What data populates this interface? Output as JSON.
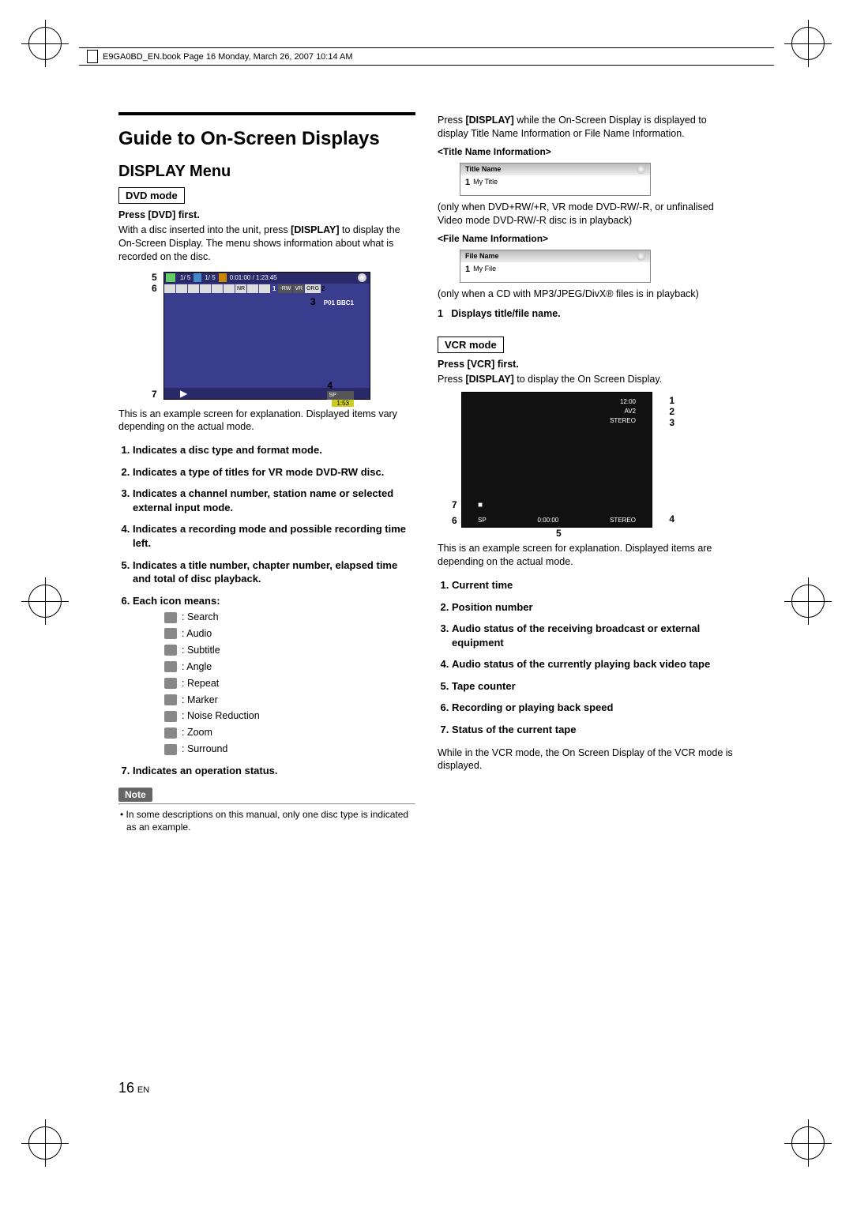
{
  "header": "E9GA0BD_EN.book  Page 16  Monday, March 26, 2007  10:14 AM",
  "h1": "Guide to On-Screen Displays",
  "h2": "DISPLAY Menu",
  "dvd_mode_label": "DVD mode",
  "dvd_press": "Press [DVD] first.",
  "dvd_intro1": "With a disc inserted into the unit, press ",
  "dvd_intro_bold": "[DISPLAY]",
  "dvd_intro2": " to display the On-Screen Display. The menu shows information about what is recorded on the disc.",
  "osb_dvd": {
    "title_count": "1/  5",
    "chapter_count": "1/  5",
    "time": "0:01:00 / 1:23:45",
    "badges": [
      "-RW",
      "VR",
      "ORG"
    ],
    "ch": "P01 BBC1",
    "rec_mode": "SP",
    "rec_left": "1:53"
  },
  "callouts_dvd": {
    "c1": "1",
    "c2": "2",
    "c3": "3",
    "c4": "4",
    "c5": "5",
    "c6": "6",
    "c7": "7"
  },
  "dvd_example_note": "This is an example screen for explanation. Displayed items vary depending on the actual mode.",
  "dvd_list": [
    "Indicates a disc type and format mode.",
    "Indicates a type of titles for VR mode DVD-RW disc.",
    "Indicates a channel number, station name or selected external input mode.",
    "Indicates a recording mode and possible recording time left.",
    "Indicates a title number, chapter number, elapsed time and total of disc playback.",
    "Each icon means:",
    "Indicates an operation status."
  ],
  "icons": [
    "Search",
    "Audio",
    "Subtitle",
    "Angle",
    "Repeat",
    "Marker",
    "Noise Reduction",
    "Zoom",
    "Surround"
  ],
  "note_label": "Note",
  "note_text": "• In some descriptions on this manual, only one disc type is indicated as an example.",
  "right_intro1": "Press ",
  "right_intro_bold": "[DISPLAY]",
  "right_intro2": " while the On-Screen Display is displayed to display Title Name Information or File Name Information.",
  "title_info_head": "<Title Name Information>",
  "title_box": {
    "bar": "Title Name",
    "num": "1",
    "val": "My Title"
  },
  "title_note": "(only when DVD+RW/+R, VR mode DVD-RW/-R, or unfinalised Video mode DVD-RW/-R disc is in playback)",
  "file_info_head": "<File Name Information>",
  "file_box": {
    "bar": "File Name",
    "num": "1",
    "val": "My File"
  },
  "file_note": "(only when a CD with MP3/JPEG/DivX® files is in playback)",
  "displays_label": "Displays title/file name.",
  "vcr_mode_label": "VCR mode",
  "vcr_press": "Press [VCR] first.",
  "vcr_intro1": "Press ",
  "vcr_intro_bold": "[DISPLAY]",
  "vcr_intro2": " to display the On Screen Display.",
  "vcr": {
    "time": "12:00",
    "pos": "AV2",
    "audio1": "STEREO",
    "sp": "SP",
    "counter": "0:00:00",
    "audio2": "STEREO",
    "stop": "■"
  },
  "callouts_vcr": {
    "c1": "1",
    "c2": "2",
    "c3": "3",
    "c4": "4",
    "c5": "5",
    "c6": "6",
    "c7": "7"
  },
  "vcr_example_note": "This is an example screen for explanation. Displayed items are depending on the actual mode.",
  "vcr_list": [
    "Current time",
    "Position number",
    "Audio status of the receiving broadcast or external equipment",
    "Audio status of the currently playing back video tape",
    "Tape counter",
    "Recording or playing back speed",
    "Status of the current tape"
  ],
  "vcr_footer": "While in the VCR mode, the On Screen Display of the VCR mode is displayed.",
  "pagenum": "16",
  "pagelang": "EN"
}
